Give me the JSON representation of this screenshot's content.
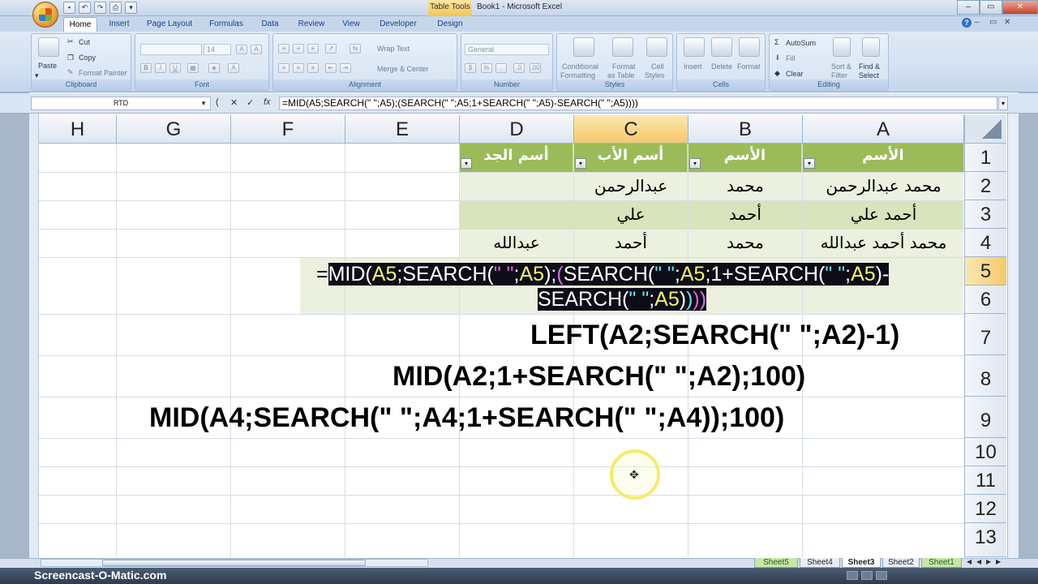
{
  "window": {
    "contextual_tab": "Table Tools",
    "title": "Book1 - Microsoft Excel",
    "minimize": "–",
    "maximize": "▭",
    "close": "✕"
  },
  "qat_icons": [
    "save-icon",
    "undo-icon",
    "redo-icon"
  ],
  "tabs": [
    "Home",
    "Insert",
    "Page Layout",
    "Formulas",
    "Data",
    "Review",
    "View",
    "Developer",
    "Design"
  ],
  "ribbon": {
    "clipboard": {
      "paste": "Paste",
      "cut": "Cut",
      "copy": "Copy",
      "format_painter": "Format Painter",
      "label": "Clipboard"
    },
    "font": {
      "size": "14",
      "bold": "B",
      "italic": "I",
      "underline": "U",
      "label": "Font"
    },
    "alignment": {
      "wrap_text": "Wrap Text",
      "merge_center": "Merge & Center",
      "label": "Alignment"
    },
    "number": {
      "format": "General",
      "label": "Number"
    },
    "styles": {
      "conditional_1": "Conditional",
      "conditional_2": "Formatting",
      "format_1": "Format",
      "format_2": "as Table",
      "cell_1": "Cell",
      "cell_2": "Styles",
      "label": "Styles"
    },
    "cells": {
      "insert": "Insert",
      "delete": "Delete",
      "format": "Format",
      "label": "Cells"
    },
    "editing": {
      "autosum": "AutoSum",
      "fill": "Fill",
      "clear": "Clear",
      "sort_1": "Sort &",
      "sort_2": "Filter",
      "find_1": "Find &",
      "find_2": "Select",
      "label": "Editing"
    }
  },
  "formula_bar": {
    "name_box": "RTD",
    "cancel": "✕",
    "enter": "✓",
    "fx": "fx",
    "formula": "=MID(A5;SEARCH(\" \";A5);(SEARCH(\" \";A5;1+SEARCH(\" \";A5)-SEARCH(\" \";A5))))"
  },
  "columns": [
    "H",
    "G",
    "F",
    "E",
    "D",
    "C",
    "B",
    "A"
  ],
  "rows": [
    "1",
    "2",
    "3",
    "4",
    "5",
    "6",
    "7",
    "8",
    "9",
    "10",
    "11",
    "12",
    "13"
  ],
  "table": {
    "headers": {
      "A": "الأسم",
      "B": "الأسم",
      "C": "أسم الأب",
      "D": "أسم الجد"
    },
    "rows": [
      {
        "A": "محمد عبدالرحمن",
        "B": "محمد",
        "C": "عبدالرحمن",
        "D": ""
      },
      {
        "A": "أحمد علي",
        "B": "أحمد",
        "C": "علي",
        "D": ""
      },
      {
        "A": "محمد أحمد عبدالله",
        "B": "محمد",
        "C": "أحمد",
        "D": "عبدالله"
      }
    ]
  },
  "edit": {
    "equals": "=",
    "l1": [
      "MID(",
      "A5",
      ";SEARCH(",
      "\" \"",
      ";",
      "A5",
      ");",
      "(",
      "SEARCH(",
      "\" \"",
      ";",
      "A5",
      ";1+SEARCH(",
      "\" \"",
      ";",
      "A5",
      ")-"
    ],
    "l2": [
      "SEARCH(",
      "\" \"",
      ";",
      "A5",
      ")",
      ")",
      ")",
      ")"
    ]
  },
  "notes": {
    "left": "LEFT(A2;SEARCH(\" \";A2)-1)",
    "mid": "MID(A2;1+SEARCH(\" \";A2);100)",
    "mid2": "MID(A4;SEARCH(\" \";A4;1+SEARCH(\" \";A4));100)"
  },
  "sheets": [
    "Sheet5",
    "Sheet4",
    "Sheet3",
    "Sheet2",
    "Sheet1"
  ],
  "active_sheet": "Sheet3",
  "watermark": "Screencast-O-Matic.com",
  "colors": {
    "table_header": "#9bbb59",
    "band_light": "#ebf1de",
    "band_dark": "#d8e4bc",
    "selection": "#f6c96a"
  }
}
